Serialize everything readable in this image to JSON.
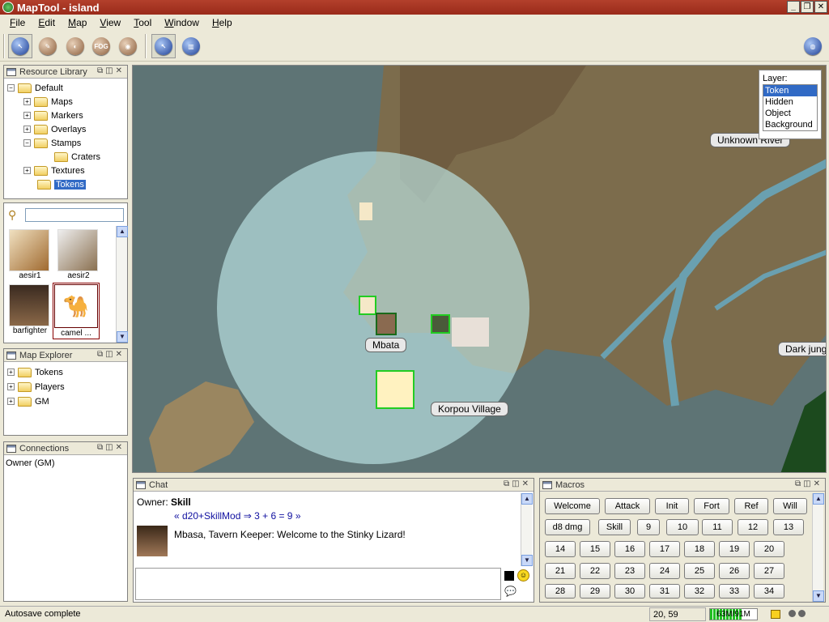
{
  "window": {
    "title": "MapTool - island"
  },
  "menu": [
    {
      "label": "File",
      "key": "F",
      "rest": "ile"
    },
    {
      "label": "Edit",
      "key": "E",
      "rest": "dit"
    },
    {
      "label": "Map",
      "key": "M",
      "rest": "ap"
    },
    {
      "label": "View",
      "key": "V",
      "rest": "iew"
    },
    {
      "label": "Tool",
      "key": "T",
      "rest": "ool"
    },
    {
      "label": "Window",
      "key": "W",
      "rest": "indow"
    },
    {
      "label": "Help",
      "key": "H",
      "rest": "elp"
    }
  ],
  "toolbar": {
    "fog_label": "FOG"
  },
  "resource_library": {
    "title": "Resource Library",
    "tree": [
      "Default",
      "Maps",
      "Markers",
      "Overlays",
      "Stamps",
      "Craters",
      "Textures",
      "Tokens"
    ],
    "search_value": "",
    "thumbs": [
      "aesir1",
      "aesir2",
      "barfighter",
      "camel ..."
    ]
  },
  "map_explorer": {
    "title": "Map Explorer",
    "items": [
      "Tokens",
      "Players",
      "GM"
    ]
  },
  "connections": {
    "title": "Connections",
    "items": [
      "Owner (GM)"
    ]
  },
  "map": {
    "labels": {
      "mbata": "Mbata",
      "korpou": "Korpou Village",
      "unknown": "Unknown River",
      "dark": "Dark jung"
    }
  },
  "layers": {
    "title": "Layer:",
    "items": [
      "Token",
      "Hidden",
      "Object",
      "Background"
    ],
    "selected": "Token"
  },
  "chat": {
    "title": "Chat",
    "line1_owner": "Owner:",
    "line1_skill": "Skill",
    "line1_roll": "« d20+SkillMod ⇒ 3 + 6 = 9 »",
    "line2": "Mbasa, Tavern Keeper:  Welcome to the Stinky Lizard!"
  },
  "macros": {
    "title": "Macros",
    "row1": [
      "Welcome",
      "Attack",
      "Init",
      "Fort",
      "Ref",
      "Will"
    ],
    "row2": [
      "d8 dmg",
      "Skill",
      "9",
      "10",
      "11",
      "12",
      "13"
    ],
    "row3": [
      "14",
      "15",
      "16",
      "17",
      "18",
      "19",
      "20"
    ],
    "row4": [
      "21",
      "22",
      "23",
      "24",
      "25",
      "26",
      "27"
    ],
    "row5": [
      "28",
      "29",
      "30",
      "31",
      "32",
      "33",
      "34"
    ]
  },
  "status": {
    "message": "Autosave complete",
    "coords": "20, 59",
    "memory": "63M/91M",
    "memory_fraction": 0.69
  }
}
